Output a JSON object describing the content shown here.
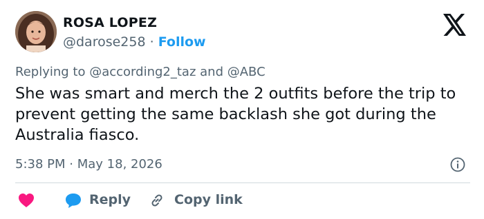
{
  "author": {
    "name": "ROSA LOPEZ",
    "handle": "@darose258",
    "separator": "·",
    "follow_label": "Follow"
  },
  "reply_context": {
    "prefix": "Replying to",
    "mention_1": "@according2_taz",
    "conjunction": "and",
    "mention_2": "@ABC"
  },
  "tweet": {
    "text": "She was smart and merch the 2 outfits before the trip to prevent getting the same backlash she got during the Australia fiasco.",
    "time": "5:38 PM",
    "separator": "·",
    "date": "May 18, 2026"
  },
  "actions": {
    "reply_label": "Reply",
    "copy_link_label": "Copy link"
  },
  "icons": {
    "brand": "x-logo-icon",
    "info": "info-icon",
    "like": "heart-icon",
    "reply": "speech-bubble-icon",
    "link": "link-icon"
  },
  "colors": {
    "text": "#0f1419",
    "secondary": "#536471",
    "accent": "#1d9bf0",
    "heart": "#f91880",
    "divider": "#cfd9de"
  }
}
